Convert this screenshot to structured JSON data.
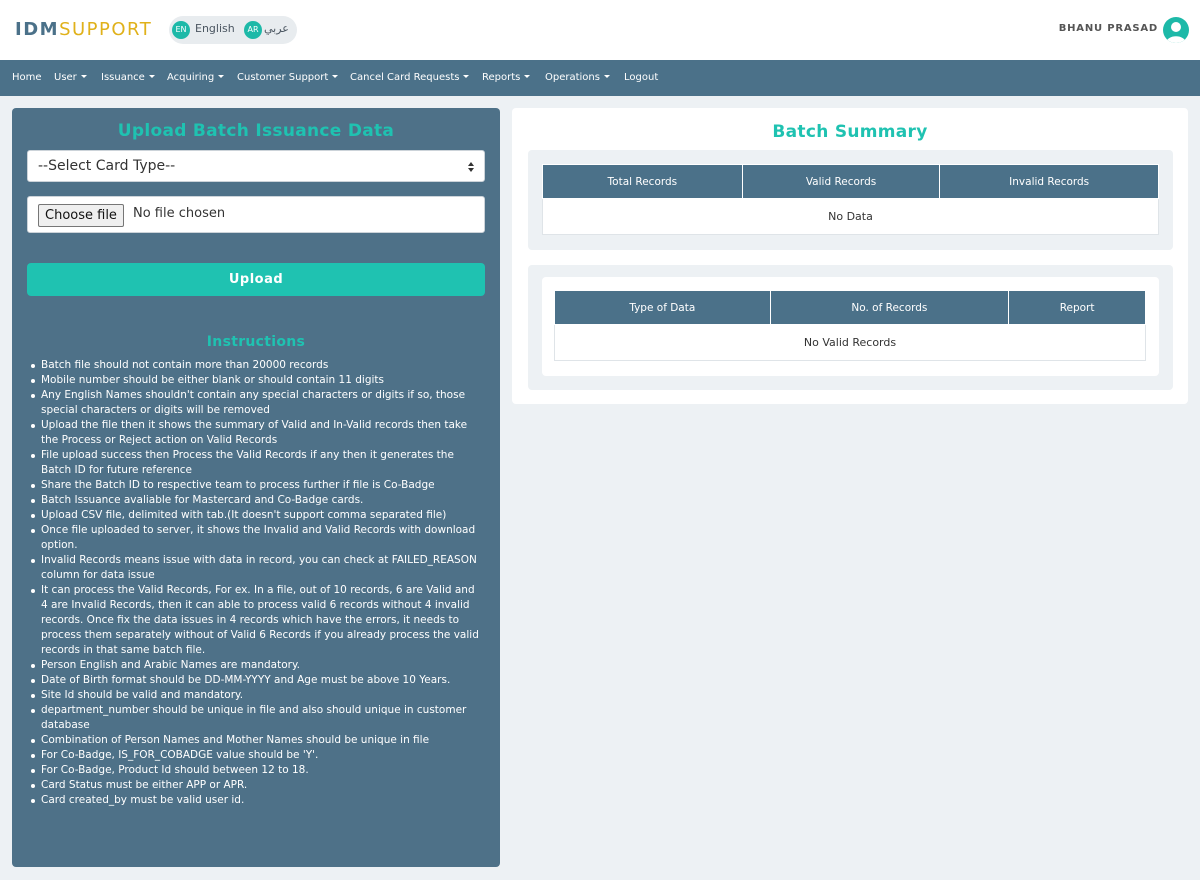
{
  "header": {
    "logo_part1": "IDM",
    "logo_part2": "SUPPORT",
    "lang_en_code": "EN",
    "lang_en_label": "English",
    "lang_ar_code": "AR",
    "lang_ar_label": "عربي",
    "user_name": "BHANU PRASAD"
  },
  "nav": {
    "items": [
      {
        "label": "Home",
        "dropdown": false
      },
      {
        "label": "User",
        "dropdown": true
      },
      {
        "label": "Issuance",
        "dropdown": true
      },
      {
        "label": "Acquiring",
        "dropdown": true
      },
      {
        "label": "Customer Support",
        "dropdown": true
      },
      {
        "label": "Cancel Card Requests",
        "dropdown": true
      },
      {
        "label": "Reports",
        "dropdown": true
      },
      {
        "label": "Operations",
        "dropdown": true
      },
      {
        "label": "Logout",
        "dropdown": false
      }
    ]
  },
  "upload": {
    "title": "Upload Batch Issuance Data",
    "card_type_selected": "--Select Card Type--",
    "file_button": "Choose file",
    "file_status": "No file chosen",
    "upload_label": "Upload"
  },
  "instructions": {
    "title": "Instructions",
    "items": [
      "Batch file should not contain more than 20000 records",
      "Mobile number should be either blank or should contain 11 digits",
      "Any English Names shouldn't contain any special characters or digits if so, those special characters or digits will be removed",
      "Upload the file then it shows the summary of Valid and In-Valid records then take the Process or Reject action on Valid Records",
      "File upload success then Process the Valid Records if any then it generates the Batch ID for future reference",
      "Share the Batch ID to respective team to process further if file is Co-Badge",
      "Batch Issuance avaliable for Mastercard and Co-Badge cards.",
      "Upload CSV file, delimited with tab.(It doesn't support comma separated file)",
      "Once file uploaded to server, it shows the Invalid and Valid Records with download option.",
      "Invalid Records means issue with data in record, you can check at FAILED_REASON column for data issue",
      "It can process the Valid Records, For ex. In a file, out of 10 records, 6 are Valid and 4 are Invalid Records, then it can able to process valid 6 records without 4 invalid records. Once fix the data issues in 4 records which have the errors, it needs to process them separately without of Valid 6 Records if you already process the valid records in that same batch file.",
      "Person English and Arabic Names are mandatory.",
      "Date of Birth format should be DD-MM-YYYY and Age must be above 10 Years.",
      "Site Id should be valid and mandatory.",
      "department_number should be unique in file and also should unique in customer database",
      "Combination of Person Names and Mother Names should be unique in file",
      "For Co-Badge, IS_FOR_COBADGE value should be 'Y'.",
      "For Co-Badge, Product Id should between 12 to 18.",
      "Card Status must be either APP or APR.",
      "Card created_by must be valid user id."
    ]
  },
  "summary": {
    "title": "Batch Summary",
    "table1": {
      "headers": [
        "Total Records",
        "Valid Records",
        "Invalid Records"
      ],
      "empty": "No Data"
    },
    "table2": {
      "headers": [
        "Type of Data",
        "No. of Records",
        "Report"
      ],
      "empty": "No Valid Records"
    }
  },
  "colors": {
    "accent": "#1fc2b1",
    "primary": "#4b7189",
    "logo_gold": "#e0b11a"
  }
}
